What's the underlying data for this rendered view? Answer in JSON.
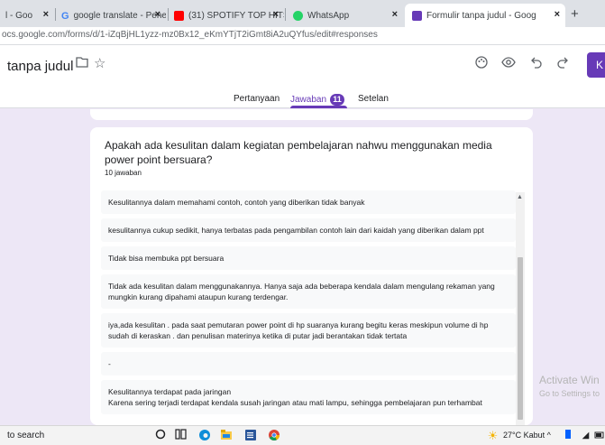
{
  "browser": {
    "tabs": [
      {
        "title": "l - Goo"
      },
      {
        "title": "google translate - Penelusur"
      },
      {
        "title": "(31) SPOTIFY TOP HITS INDO"
      },
      {
        "title": "WhatsApp"
      },
      {
        "title": "Formulir tanpa judul - Goog"
      }
    ],
    "url": "ocs.google.com/forms/d/1-iZqBjHL1yzz-mz0Bx12_eKmYTjT2iGmt8iA2uQYfus/edit#responses"
  },
  "form": {
    "title": "tanpa judul",
    "send_label": "K",
    "nav": {
      "questions": "Pertanyaan",
      "responses": "Jawaban",
      "response_count": "11",
      "settings": "Setelan"
    },
    "question": {
      "text": "Apakah ada kesulitan dalam kegiatan pembelajaran nahwu menggunakan media power point bersuara?",
      "answer_count": "10 jawaban",
      "responses": [
        "Kesulitannya dalam memahami contoh, contoh yang diberikan tidak banyak",
        "kesulitannya cukup sedikit, hanya terbatas pada pengambilan contoh lain dari kaidah yang diberikan dalam ppt",
        "Tidak bisa membuka ppt bersuara",
        "Tidak ada kesulitan dalam menggunakannya. Hanya saja ada beberapa kendala dalam mengulang rekaman yang mungkin kurang dipahami ataupun kurang terdengar.",
        "iya,ada kesulitan . pada saat pemutaran power point di hp suaranya kurang begitu keras meskipun volume di hp sudah di keraskan . dan penulisan materinya ketika di putar jadi berantakan tidak tertata",
        "-",
        "Kesulitannya terdapat pada jaringan\nKarena sering terjadi terdapat kendala susah jaringan atau mati lampu, sehingga pembelajaran pun terhambat"
      ]
    }
  },
  "watermark": {
    "line1": "Activate Win",
    "line2": "Go to Settings to"
  },
  "taskbar": {
    "search": "to search",
    "weather": "27°C  Kabut  ^"
  },
  "colors": {
    "accent": "#673ab7",
    "background": "#ede7f6"
  }
}
